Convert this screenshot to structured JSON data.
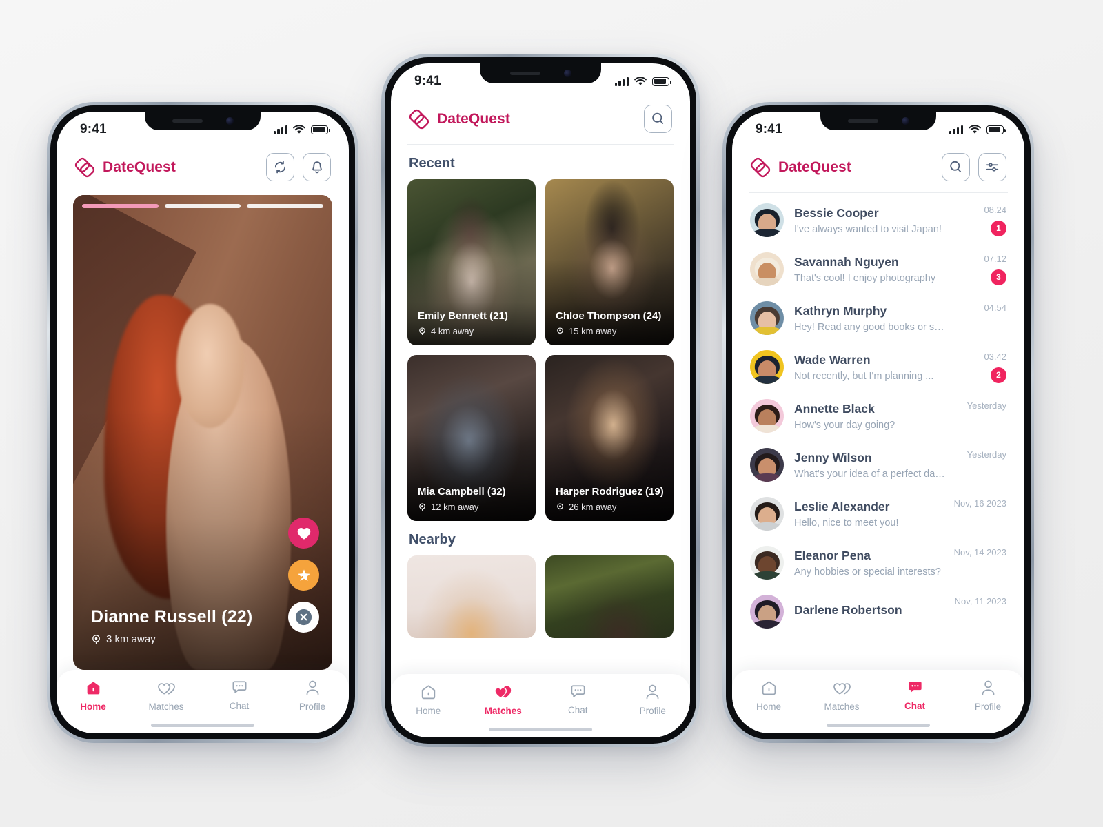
{
  "app": {
    "name": "DateQuest",
    "accent": "#ee2a66",
    "brand_color": "#c2185b",
    "badge_color": "#f0245f"
  },
  "status_bar": {
    "time": "9:41",
    "signal_icon": "signal-bars-icon",
    "wifi_icon": "wifi-icon",
    "battery_icon": "battery-icon"
  },
  "nav": {
    "items": [
      {
        "label": "Home",
        "icon": "home-icon"
      },
      {
        "label": "Matches",
        "icon": "double-heart-icon"
      },
      {
        "label": "Chat",
        "icon": "chat-bubble-icon"
      },
      {
        "label": "Profile",
        "icon": "person-icon"
      }
    ]
  },
  "screen_home": {
    "active_tab": "Home",
    "header": {
      "title": "DateQuest",
      "logo_icon": "datequest-logo-icon",
      "actions": [
        {
          "name": "refresh-button",
          "icon": "refresh-icon"
        },
        {
          "name": "notifications-button",
          "icon": "bell-icon"
        }
      ]
    },
    "card": {
      "name": "Dianne Russell (22)",
      "distance": "3 km away",
      "location_icon": "location-pin-icon",
      "photo_count": 3,
      "active_photo": 1,
      "actions": [
        {
          "name": "like-button",
          "icon": "heart-icon",
          "color": "#e0296b"
        },
        {
          "name": "superlike-button",
          "icon": "star-icon",
          "color": "#f5a33c"
        },
        {
          "name": "dislike-button",
          "icon": "close-icon",
          "color": "#ffffff"
        }
      ]
    }
  },
  "screen_matches": {
    "active_tab": "Matches",
    "header": {
      "title": "DateQuest",
      "logo_icon": "datequest-logo-icon",
      "actions": [
        {
          "name": "search-button",
          "icon": "search-icon"
        }
      ]
    },
    "sections": [
      {
        "title": "Recent",
        "cards": [
          {
            "name": "Emily Bennett (21)",
            "distance": "4 km away",
            "photo": "p-emily"
          },
          {
            "name": "Chloe Thompson (24)",
            "distance": "15 km away",
            "photo": "p-chloe"
          },
          {
            "name": "Mia Campbell (32)",
            "distance": "12 km away",
            "photo": "p-mia"
          },
          {
            "name": "Harper Rodriguez (19)",
            "distance": "26 km away",
            "photo": "p-harper"
          }
        ]
      },
      {
        "title": "Nearby",
        "cards": [
          {
            "name": "",
            "distance": "",
            "photo": "p-n1"
          },
          {
            "name": "",
            "distance": "",
            "photo": "p-n2"
          }
        ]
      }
    ]
  },
  "screen_chat": {
    "active_tab": "Chat",
    "header": {
      "title": "DateQuest",
      "logo_icon": "datequest-logo-icon",
      "actions": [
        {
          "name": "search-button",
          "icon": "search-icon"
        },
        {
          "name": "filter-button",
          "icon": "sliders-icon"
        }
      ]
    },
    "conversations": [
      {
        "name": "Bessie Cooper",
        "message": "I've always wanted to visit Japan!",
        "time": "08.24",
        "unread": "1",
        "avatar_bg": "#cfe0e6",
        "hair": "#17202b",
        "skin": "#d8a98a"
      },
      {
        "name": "Savannah Nguyen",
        "message": "That's cool! I enjoy photography",
        "time": "07.12",
        "unread": "3",
        "avatar_bg": "#efe0cd",
        "hair": "#efe6d8",
        "skin": "#c98f63"
      },
      {
        "name": "Kathryn Murphy",
        "message": "Hey! Read any good books or seen ...",
        "time": "04.54",
        "unread": "",
        "avatar_bg": "#6f8ea6",
        "hair": "#4a3b33",
        "skin": "#e6bfa4"
      },
      {
        "name": "Wade Warren",
        "message": "Not recently, but I'm planning ...",
        "time": "03.42",
        "unread": "2",
        "avatar_bg": "#f0c420",
        "hair": "#1b2230",
        "skin": "#c98b68"
      },
      {
        "name": "Annette Black",
        "message": "How's your day going?",
        "time": "Yesterday",
        "unread": "",
        "avatar_bg": "#f3c9da",
        "hair": "#2c1d18",
        "skin": "#b9805d"
      },
      {
        "name": "Jenny Wilson",
        "message": "What's your idea of a perfect date?",
        "time": "Yesterday",
        "unread": "",
        "avatar_bg": "#3c3a4a",
        "hair": "#221a1b",
        "skin": "#c98f6c"
      },
      {
        "name": "Leslie Alexander",
        "message": "Hello, nice to meet you!",
        "time": "Nov, 16 2023",
        "unread": "",
        "avatar_bg": "#dfe1e2",
        "hair": "#241b18",
        "skin": "#dcae8d"
      },
      {
        "name": "Eleanor Pena",
        "message": "Any hobbies or special interests?",
        "time": "Nov, 14 2023",
        "unread": "",
        "avatar_bg": "#eef0ee",
        "hair": "#3b2a22",
        "skin": "#6d452f"
      },
      {
        "name": "Darlene Robertson",
        "message": "",
        "time": "Nov, 11 2023",
        "unread": "",
        "avatar_bg": "#d3b2d8",
        "hair": "#1f1b26",
        "skin": "#caa184"
      }
    ]
  }
}
